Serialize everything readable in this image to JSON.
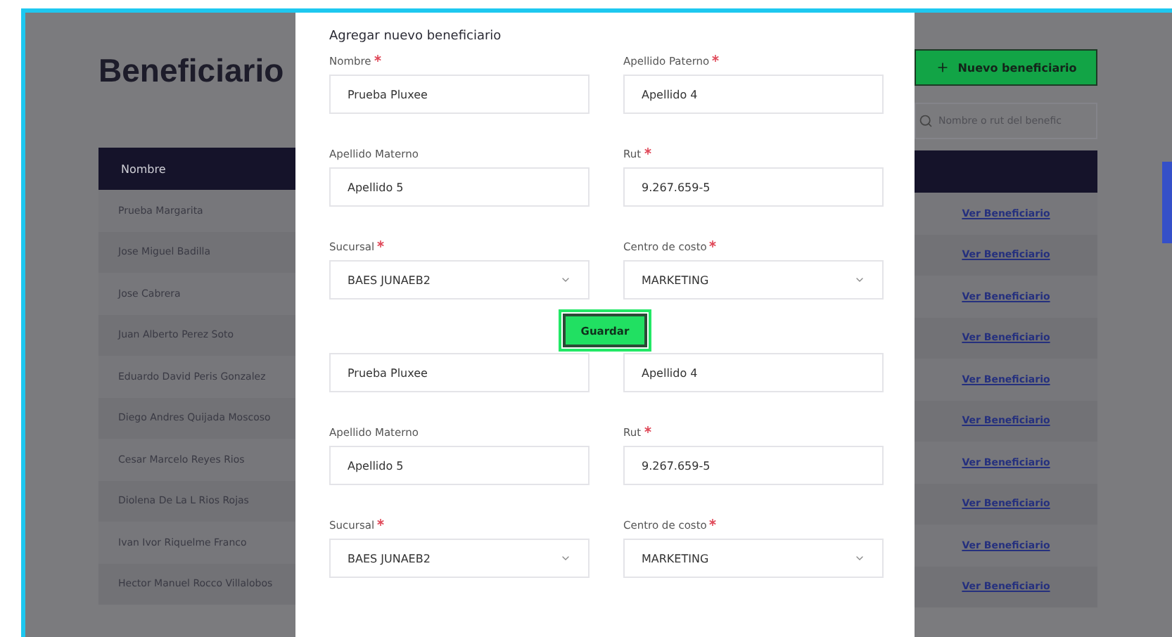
{
  "page": {
    "title": "Beneficiario",
    "new_button": "Nuevo beneficiario"
  },
  "search": {
    "placeholder": "Nombre o rut del benefic"
  },
  "table": {
    "columns": [
      "Nombre"
    ],
    "rows": [
      {
        "name": "Prueba Margarita",
        "action": "Ver Beneficiario"
      },
      {
        "name": "Jose Miguel Badilla",
        "action": "Ver Beneficiario"
      },
      {
        "name": "Jose Cabrera",
        "action": "Ver Beneficiario"
      },
      {
        "name": "Juan Alberto Perez Soto",
        "action": "Ver Beneficiario"
      },
      {
        "name": "Eduardo David Peris Gonzalez",
        "action": "Ver Beneficiario"
      },
      {
        "name": "Diego Andres Quijada Moscoso",
        "action": "Ver Beneficiario"
      },
      {
        "name": "Cesar Marcelo Reyes Rios",
        "action": "Ver Beneficiario"
      },
      {
        "name": "Diolena De La L Rios Rojas",
        "action": "Ver Beneficiario"
      },
      {
        "name": "Ivan Ivor Riquelme Franco",
        "action": "Ver Beneficiario"
      },
      {
        "name": "Hector Manuel Rocco Villalobos",
        "action": "Ver Beneficiario"
      }
    ]
  },
  "modal": {
    "title": "Agregar nuevo beneficiario",
    "sections": [
      {
        "fields": [
          {
            "label": "Nombre",
            "required": true,
            "value": "Prueba Pluxee",
            "kind": "input"
          },
          {
            "label": "Apellido Paterno",
            "required": true,
            "value": "Apellido 4",
            "kind": "input"
          },
          {
            "label": "Apellido Materno",
            "required": false,
            "value": "Apellido 5",
            "kind": "input"
          },
          {
            "label": "Rut",
            "required": true,
            "value": "9.267.659-5",
            "kind": "input"
          },
          {
            "label": "Sucursal",
            "required": true,
            "value": "BAES JUNAEB2",
            "kind": "select"
          },
          {
            "label": "Centro de costo",
            "required": true,
            "value": "MARKETING",
            "kind": "select"
          }
        ]
      },
      {
        "fields": [
          {
            "value": "Prueba Pluxee",
            "kind": "input"
          },
          {
            "value": "Apellido 4",
            "kind": "input"
          },
          {
            "label": "Apellido Materno",
            "required": false,
            "value": "Apellido 5",
            "kind": "input"
          },
          {
            "label": "Rut",
            "required": true,
            "value": "9.267.659-5",
            "kind": "input"
          },
          {
            "label": "Sucursal",
            "required": true,
            "value": "BAES JUNAEB2",
            "kind": "select"
          },
          {
            "label": "Centro de costo",
            "required": true,
            "value": "MARKETING",
            "kind": "select"
          }
        ]
      }
    ],
    "button": "Guardar"
  }
}
